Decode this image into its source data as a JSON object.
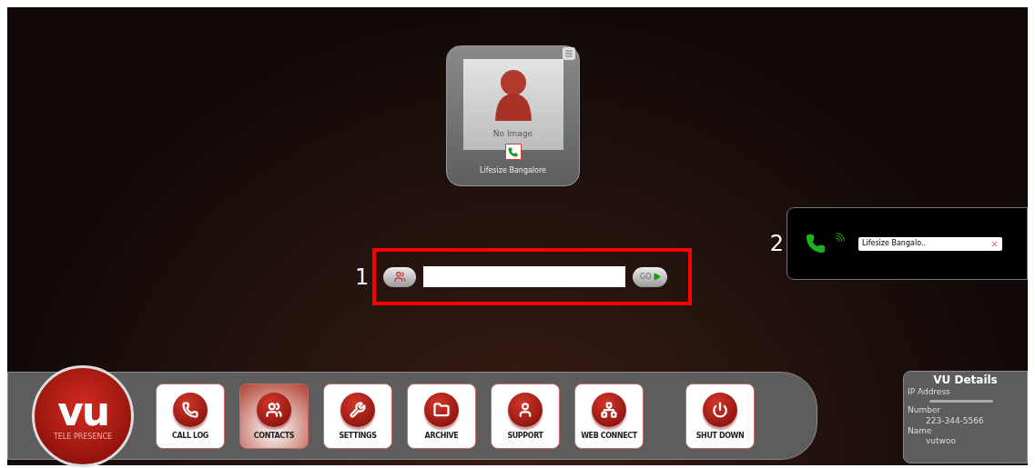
{
  "contact_card": {
    "image_caption": "No Image",
    "name": "Lifesize Bangalore"
  },
  "dial_bar": {
    "marker": "1",
    "go_label": "GO"
  },
  "active_call": {
    "marker": "2",
    "name": "Lifesize Bangalo.."
  },
  "logo": {
    "title": "vu",
    "subtitle": "TELE PRESENCE"
  },
  "nav": [
    {
      "label": "CALL LOG",
      "selected": false
    },
    {
      "label": "CONTACTS",
      "selected": true
    },
    {
      "label": "SETTINGS",
      "selected": false
    },
    {
      "label": "ARCHIVE",
      "selected": false
    },
    {
      "label": "SUPPORT",
      "selected": false
    },
    {
      "label": "WEB CONNECT",
      "selected": false
    },
    {
      "label": "SHUT DOWN",
      "selected": false
    }
  ],
  "details": {
    "title": "VU Details",
    "fields": [
      {
        "label": "IP Address"
      },
      {
        "label": "Number",
        "value": "223-344-5566"
      },
      {
        "label": "Name",
        "value": "vutwoo"
      }
    ]
  }
}
